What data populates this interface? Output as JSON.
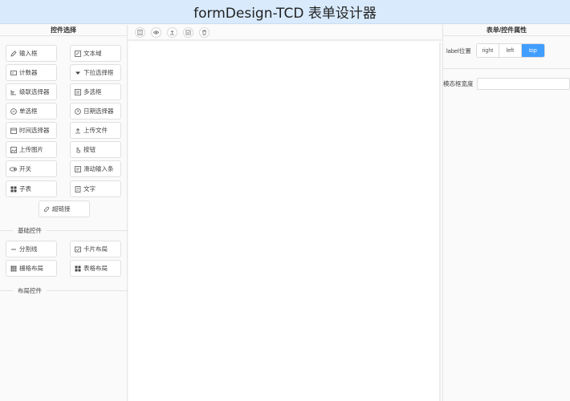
{
  "app": {
    "title": "formDesign-TCD 表单设计器"
  },
  "left_panel": {
    "title": "控件选择",
    "basic_controls": [
      {
        "label": "输入框",
        "icon": "edit-icon"
      },
      {
        "label": "文本域",
        "icon": "textarea-icon"
      },
      {
        "label": "计数器",
        "icon": "counter-icon"
      },
      {
        "label": "下拉选择框",
        "icon": "caret-down-icon"
      },
      {
        "label": "级联选择器",
        "icon": "cascade-icon"
      },
      {
        "label": "多选框",
        "icon": "checkbox-icon"
      },
      {
        "label": "单选框",
        "icon": "radio-icon"
      },
      {
        "label": "日期选择器",
        "icon": "calendar-icon"
      },
      {
        "label": "时间选择器",
        "icon": "clock-icon"
      },
      {
        "label": "上传文件",
        "icon": "upload-icon"
      },
      {
        "label": "上传图片",
        "icon": "image-icon"
      },
      {
        "label": "按钮",
        "icon": "pointer-icon"
      },
      {
        "label": "开关",
        "icon": "switch-icon"
      },
      {
        "label": "滑动输入条",
        "icon": "slider-icon"
      },
      {
        "label": "子表",
        "icon": "grid-icon"
      },
      {
        "label": "文字",
        "icon": "text-icon"
      },
      {
        "label": "超链接",
        "icon": "link-icon"
      }
    ],
    "basic_section_label": "基础控件",
    "layout_controls": [
      {
        "label": "分割线",
        "icon": "divider-icon"
      },
      {
        "label": "卡片布局",
        "icon": "card-icon"
      },
      {
        "label": "栅格布局",
        "icon": "table-grid-icon"
      },
      {
        "label": "表格布局",
        "icon": "grid-icon"
      }
    ],
    "layout_section_label": "布局控件"
  },
  "toolbar": {
    "buttons": [
      {
        "name": "preview-form-icon"
      },
      {
        "name": "eye-icon"
      },
      {
        "name": "import-icon"
      },
      {
        "name": "export-icon"
      },
      {
        "name": "delete-icon"
      }
    ]
  },
  "right_panel": {
    "title": "表单/控件属性",
    "label_position": {
      "label": "label位置",
      "options": [
        "right",
        "left",
        "top"
      ],
      "selected": "top"
    },
    "modal_width": {
      "label": "模态框宽度",
      "value": "",
      "placeholder": ""
    }
  },
  "colors": {
    "header_bg": "#d8eafc",
    "accent": "#409eff"
  }
}
